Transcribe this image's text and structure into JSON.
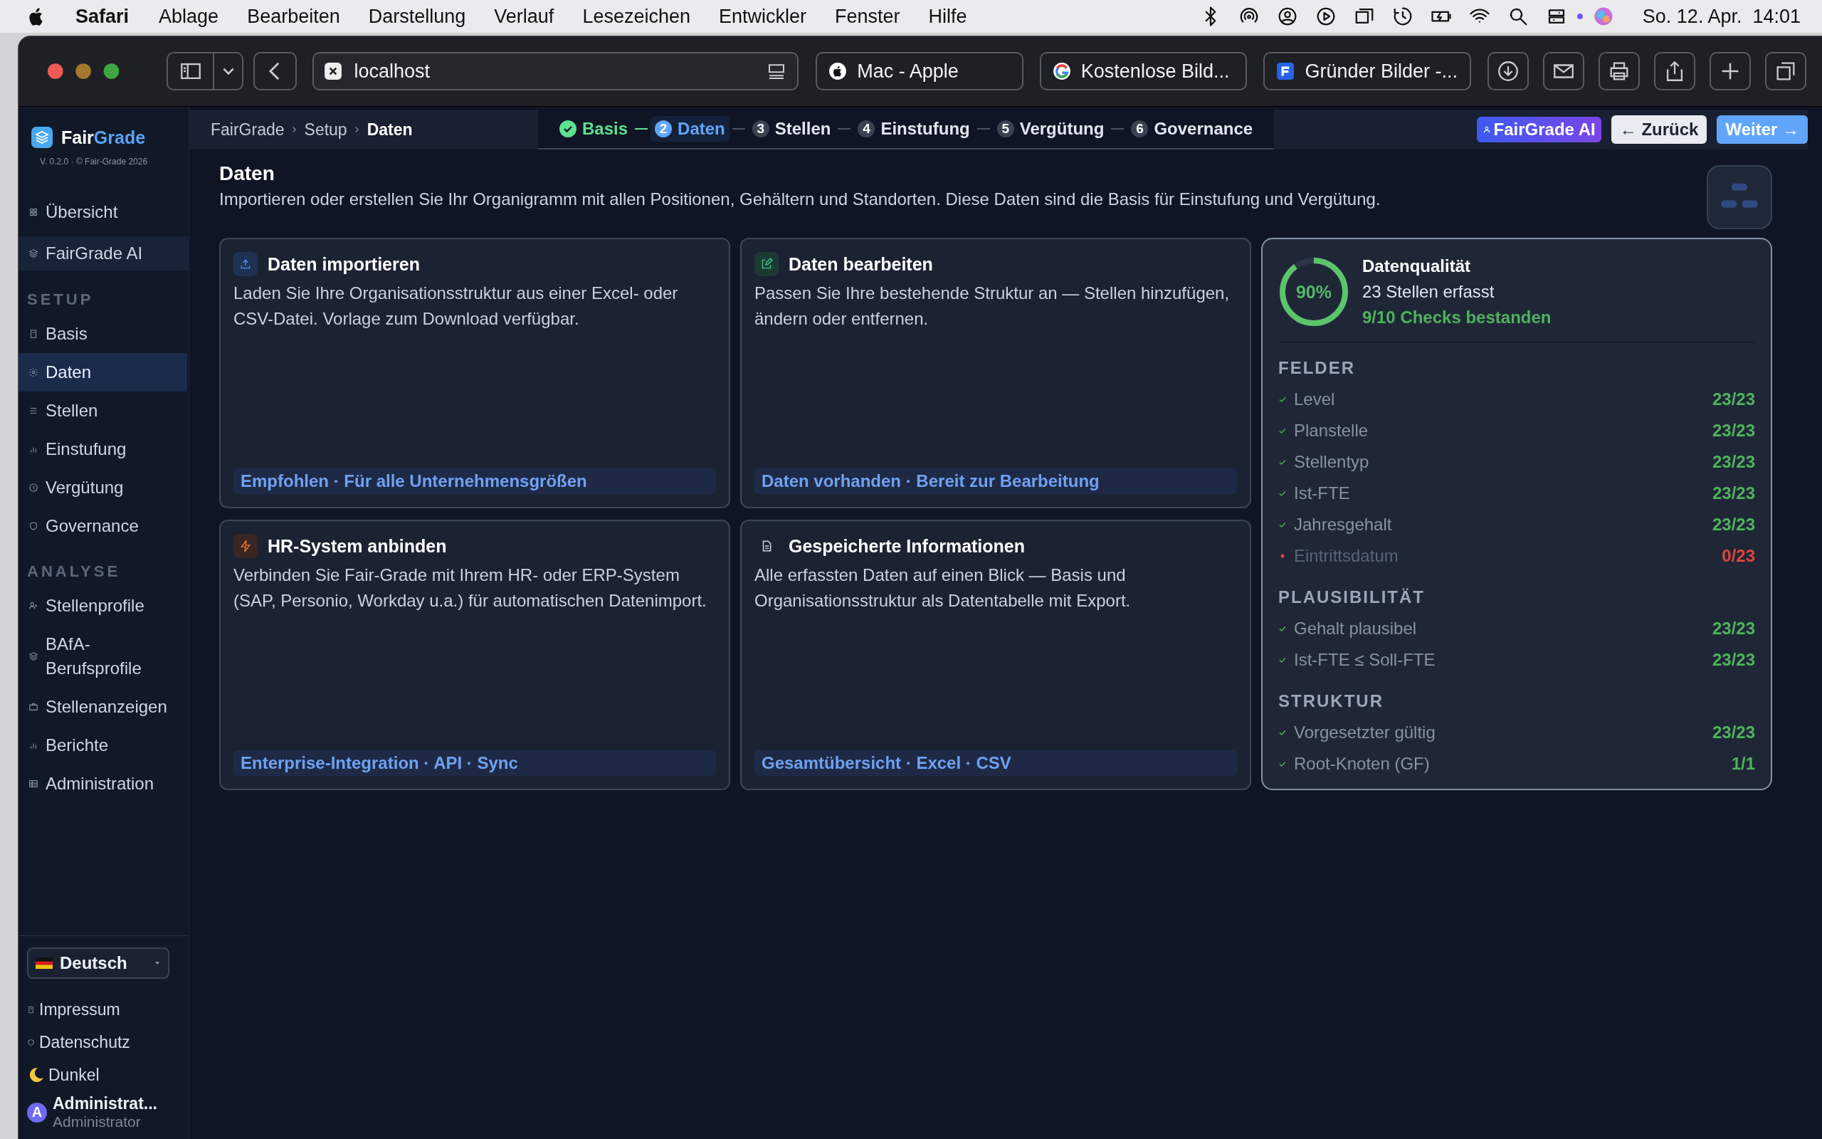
{
  "menu_bar": {
    "app": "Safari",
    "menus": [
      "Ablage",
      "Bearbeiten",
      "Darstellung",
      "Verlauf",
      "Lesezeichen",
      "Entwickler",
      "Fenster",
      "Hilfe"
    ],
    "clock": "So. 12. Apr.  14:01"
  },
  "browser": {
    "address": "localhost",
    "tabs": [
      {
        "title": "Mac - Apple",
        "selected": false
      },
      {
        "title": "Kostenlose Bild...",
        "selected": false
      },
      {
        "title": "Gründer Bilder -...",
        "selected": false
      }
    ]
  },
  "sidebar": {
    "brand": {
      "first": "Fair",
      "second": "Grade"
    },
    "version": "V. 0.2.0 · © Fair-Grade 2026",
    "items": [
      {
        "label": "Übersicht",
        "kind": "link",
        "selected": false
      },
      {
        "label": "FairGrade AI",
        "kind": "featured",
        "selected": false
      }
    ],
    "sections": [
      {
        "title": "SETUP",
        "items": [
          {
            "label": "Basis",
            "selected": false
          },
          {
            "label": "Daten",
            "selected": true
          },
          {
            "label": "Stellen",
            "selected": false
          },
          {
            "label": "Einstufung",
            "selected": false
          },
          {
            "label": "Vergütung",
            "selected": false
          },
          {
            "label": "Governance",
            "selected": false
          }
        ]
      },
      {
        "title": "ANALYSE",
        "items": [
          {
            "label": "Stellenprofile",
            "selected": false
          },
          {
            "label": "BAfA-Berufsprofile",
            "selected": false
          },
          {
            "label": "Stellenanzeigen",
            "selected": false
          },
          {
            "label": "Berichte",
            "selected": false
          },
          {
            "label": "Administration",
            "selected": false
          }
        ]
      }
    ],
    "language": "Deutsch",
    "links": [
      "Impressum",
      "Datenschutz"
    ],
    "theme": "Dunkel",
    "user": {
      "initial": "A",
      "name": "Administrat...",
      "role": "Administrator"
    }
  },
  "header": {
    "breadcrumb": [
      "FairGrade",
      "Setup",
      "Daten"
    ],
    "steps": [
      {
        "label": "Basis",
        "done": true,
        "selected": false
      },
      {
        "number": "2",
        "label": "Daten",
        "done": false,
        "selected": true
      },
      {
        "number": "3",
        "label": "Stellen",
        "done": false,
        "selected": false
      },
      {
        "number": "4",
        "label": "Einstufung",
        "done": false,
        "selected": false
      },
      {
        "number": "5",
        "label": "Vergütung",
        "done": false,
        "selected": false
      },
      {
        "number": "6",
        "label": "Governance",
        "done": false,
        "selected": false
      }
    ],
    "ai_button": "FairGrade AI",
    "back_button": "← Zurück",
    "next_button": "Weiter →"
  },
  "page": {
    "title": "Daten",
    "description": "Importieren oder erstellen Sie Ihr Organigramm mit allen Positionen, Gehältern und Standorten. Diese Daten sind die Basis für Einstufung und Vergütung."
  },
  "cards": [
    {
      "kind": "import",
      "title": "Daten importieren",
      "text": "Laden Sie Ihre Organisationsstruktur aus einer Excel- oder CSV-Datei. Vorlage zum Download verfügbar.",
      "footer": "Empfohlen · Für alle Unternehmensgrößen"
    },
    {
      "kind": "edit",
      "title": "Daten bearbeiten",
      "text": "Passen Sie Ihre bestehende Struktur an — Stellen hinzufügen, ändern oder entfernen.",
      "footer": "Daten vorhanden · Bereit zur Bearbeitung"
    },
    {
      "kind": "connect",
      "title": "HR-System anbinden",
      "text": "Verbinden Sie Fair-Grade mit Ihrem HR- oder ERP-System (SAP, Personio, Workday u.a.) für automatischen Datenimport.",
      "footer": "Enterprise-Integration · API · Sync"
    },
    {
      "kind": "saved",
      "title": "Gespeicherte Informationen",
      "text": "Alle erfassten Daten auf einen Blick — Basis und Organisationsstruktur als Datentabelle mit Export.",
      "footer": "Gesamtübersicht · Excel · CSV"
    }
  ],
  "quality": {
    "level": 0.9,
    "percent": "90%",
    "title": "Datenqualität",
    "subtitle": "23 Stellen erfasst",
    "summary": "9/10 Checks bestanden",
    "groups": [
      {
        "title": "FELDER",
        "rows": [
          {
            "label": "Level",
            "value": "23/23",
            "ok": true
          },
          {
            "label": "Planstelle",
            "value": "23/23",
            "ok": true
          },
          {
            "label": "Stellentyp",
            "value": "23/23",
            "ok": true
          },
          {
            "label": "Ist-FTE",
            "value": "23/23",
            "ok": true
          },
          {
            "label": "Jahresgehalt",
            "value": "23/23",
            "ok": true
          },
          {
            "label": "Eintrittsdatum",
            "value": "0/23",
            "ok": false
          }
        ]
      },
      {
        "title": "PLAUSIBILITÄT",
        "rows": [
          {
            "label": "Gehalt plausibel",
            "value": "23/23",
            "ok": true
          },
          {
            "label": "Ist-FTE ≤ Soll-FTE",
            "value": "23/23",
            "ok": true
          }
        ]
      },
      {
        "title": "STRUKTUR",
        "rows": [
          {
            "label": "Vorgesetzter gültig",
            "value": "23/23",
            "ok": true
          },
          {
            "label": "Root-Knoten (GF)",
            "value": "1/1",
            "ok": true
          }
        ]
      }
    ]
  }
}
